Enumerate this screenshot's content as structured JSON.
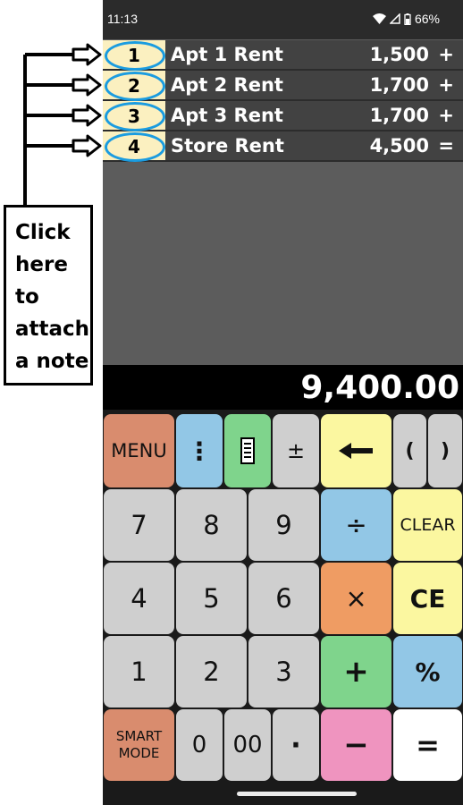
{
  "status": {
    "time": "11:13",
    "battery": "66%"
  },
  "tape": [
    {
      "num": "1",
      "label": "Apt 1 Rent",
      "amount": "1,500",
      "op": "+"
    },
    {
      "num": "2",
      "label": "Apt 2 Rent",
      "amount": "1,700",
      "op": "+"
    },
    {
      "num": "3",
      "label": "Apt 3 Rent",
      "amount": "1,700",
      "op": "+"
    },
    {
      "num": "4",
      "label": "Store Rent",
      "amount": "4,500",
      "op": "="
    }
  ],
  "display": "9,400.00",
  "note": {
    "line1": "Click",
    "line2": "here",
    "line3": "to",
    "line4": "attach",
    "line5": "a note"
  },
  "keys": {
    "menu": "MENU",
    "more": "⋮",
    "plusminus": "±",
    "lparen": "(",
    "rparen": ")",
    "divide": "÷",
    "clear": "CLEAR",
    "multiply": "×",
    "ce": "CE",
    "plus": "+",
    "percent": "%",
    "smart_line1": "SMART",
    "smart_line2": "MODE",
    "minus": "−",
    "equals": "=",
    "d0": "0",
    "d00": "00",
    "dot": "·",
    "d1": "1",
    "d2": "2",
    "d3": "3",
    "d4": "4",
    "d5": "5",
    "d6": "6",
    "d7": "7",
    "d8": "8",
    "d9": "9"
  }
}
